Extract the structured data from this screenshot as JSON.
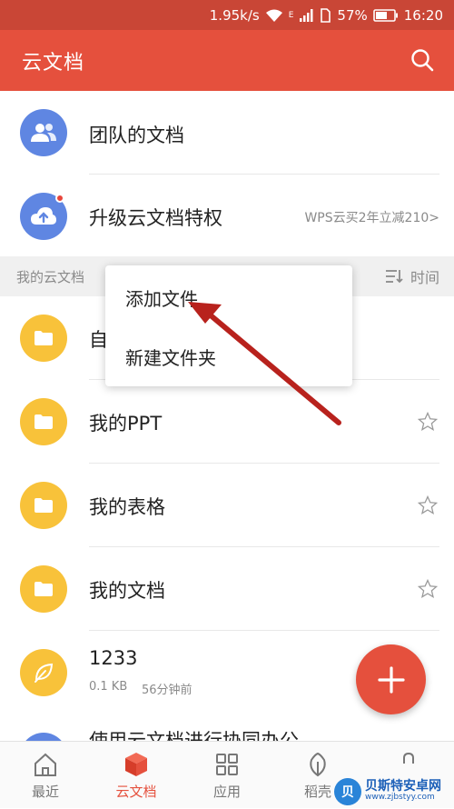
{
  "status_bar": {
    "speed": "1.95k/s",
    "network": "E",
    "battery": "57%",
    "time": "16:20"
  },
  "app_bar": {
    "title": "云文档"
  },
  "top_rows": [
    {
      "label": "团队的文档"
    },
    {
      "label": "升级云文档特权",
      "promo": "WPS云买2年立减210>"
    }
  ],
  "section": {
    "title": "我的云文档",
    "sort_label": "时间"
  },
  "files": [
    {
      "name": "自"
    },
    {
      "name": "我的PPT"
    },
    {
      "name": "我的表格"
    },
    {
      "name": "我的文档"
    },
    {
      "name": "1233",
      "size": "0.1 KB",
      "time": "56分钟前"
    },
    {
      "name": "使用云文档进行协同办公"
    }
  ],
  "popup_menu": {
    "items": [
      "添加文件",
      "新建文件夹"
    ]
  },
  "bottom_nav": [
    {
      "label": "最近"
    },
    {
      "label": "云文档"
    },
    {
      "label": "应用"
    },
    {
      "label": "稻壳"
    }
  ],
  "watermark": {
    "main": "贝斯特安卓网",
    "url": "www.zjbstyy.com"
  },
  "colors": {
    "accent": "#e5503d",
    "status_bar": "#c94636",
    "avatar_blue": "#5f86e2",
    "folder_yellow": "#f8c23a",
    "arrow": "#b8221d"
  }
}
